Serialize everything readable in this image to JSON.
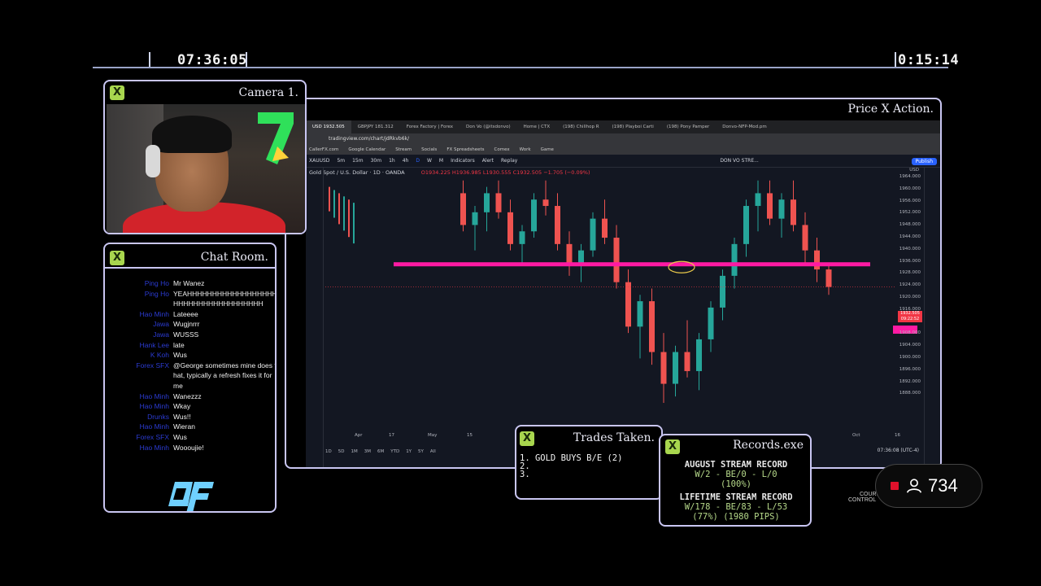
{
  "clocks": {
    "left": "07:36:05",
    "right": "0:15:14"
  },
  "camera": {
    "badge": "X",
    "title": "Camera 1."
  },
  "chat": {
    "badge": "X",
    "title": "Chat Room.",
    "messages": [
      {
        "user": "Ping Ho",
        "text": "Mr Wanez"
      },
      {
        "user": "Ping Ho",
        "text": "YEAHHHHHHHHHHHHHHHHHHHHHHHHHHHHHHHHHHHH"
      },
      {
        "user": "Hao Minh",
        "text": "Lateeee"
      },
      {
        "user": "Jawa",
        "text": "Wugjnrrr"
      },
      {
        "user": "Jawa",
        "text": "WUSSS"
      },
      {
        "user": "Hank Lee",
        "text": "late"
      },
      {
        "user": "K Koh",
        "text": "Wus"
      },
      {
        "user": "Forex SFX",
        "text": "@George sometimes mine does that, typically a refresh fixes it for me"
      },
      {
        "user": "Hao Minh",
        "text": "Wanezzz"
      },
      {
        "user": "Hao Minh",
        "text": "Wkay"
      },
      {
        "user": "Drunks",
        "text": "Wus!!"
      },
      {
        "user": "Hao Minh",
        "text": "Wieran"
      },
      {
        "user": "Forex SFX",
        "text": "Wus"
      },
      {
        "user": "Hao Minh",
        "text": "Woooujie!"
      }
    ]
  },
  "chart_panel": {
    "title": "Price X Action.",
    "tabs": [
      "USD 1932.505",
      "GBPJPY 181.312",
      "Forex Factory | Forex",
      "Don Vo (@itsdonvo)",
      "Home | CTX",
      "(198) Chillhop R",
      "(198) Playboi Carti",
      "(198) Pony Pamper",
      "Donvo-NFP-Mod.pm"
    ],
    "url": "tradingview.com/chart/jdRkvb6k/",
    "bookmarks": [
      "CallerFX.com",
      "Google Calendar",
      "Stream",
      "Socials",
      "FX Spreadsheets",
      "Comex",
      "Work",
      "Game"
    ],
    "toolbar": [
      "XAUUSD",
      "5m",
      "15m",
      "30m",
      "1h",
      "4h",
      "D",
      "W",
      "M",
      "Indicators",
      "Alert",
      "Replay"
    ],
    "layout_name": "DON VO STRE...",
    "publish": "Publish",
    "symbol": "Gold Spot / U.S. Dollar · 1D · OANDA",
    "ohlc": "O1934.225 H1936.985 L1930.555 C1932.505 −1.705 (−0.09%)",
    "currency": "USD",
    "y_ticks": [
      "1964.000",
      "1960.000",
      "1956.000",
      "1952.000",
      "1948.000",
      "1944.000",
      "1940.000",
      "1936.000",
      "1928.000",
      "1924.000",
      "1920.000",
      "1916.000",
      "1912.000",
      "1908.000",
      "1904.000",
      "1900.000",
      "1896.000",
      "1892.000",
      "1888.000"
    ],
    "x_ticks": [
      "Apr",
      "17",
      "May",
      "15",
      "Jun",
      "Oct",
      "16"
    ],
    "price_tag": "1932.505",
    "price_tag_time": "09:22:52",
    "ranges": [
      "1D",
      "5D",
      "1M",
      "3M",
      "6M",
      "YTD",
      "1Y",
      "5Y",
      "All"
    ],
    "time_utc": "07:36:08 (UTC-4)"
  },
  "chart_data": {
    "type": "candlestick",
    "symbol": "XAUUSD",
    "timeframe": "1D",
    "horizontal_line": 1939.5,
    "ylim": [
      1886,
      1968
    ],
    "candles": [
      [
        1962,
        1966,
        1950,
        1952
      ],
      [
        1952,
        1958,
        1944,
        1956
      ],
      [
        1956,
        1964,
        1950,
        1962
      ],
      [
        1962,
        1966,
        1954,
        1956
      ],
      [
        1956,
        1960,
        1944,
        1946
      ],
      [
        1946,
        1952,
        1940,
        1950
      ],
      [
        1950,
        1962,
        1948,
        1960
      ],
      [
        1960,
        1966,
        1955,
        1958
      ],
      [
        1958,
        1962,
        1944,
        1946
      ],
      [
        1946,
        1950,
        1936,
        1940
      ],
      [
        1940,
        1946,
        1934,
        1944
      ],
      [
        1944,
        1956,
        1942,
        1954
      ],
      [
        1954,
        1960,
        1946,
        1948
      ],
      [
        1948,
        1952,
        1932,
        1934
      ],
      [
        1934,
        1938,
        1918,
        1920
      ],
      [
        1920,
        1930,
        1910,
        1928
      ],
      [
        1928,
        1932,
        1908,
        1912
      ],
      [
        1912,
        1918,
        1896,
        1902
      ],
      [
        1902,
        1914,
        1898,
        1912
      ],
      [
        1912,
        1922,
        1904,
        1906
      ],
      [
        1906,
        1918,
        1900,
        1916
      ],
      [
        1916,
        1928,
        1912,
        1926
      ],
      [
        1926,
        1938,
        1922,
        1936
      ],
      [
        1936,
        1948,
        1932,
        1946
      ],
      [
        1946,
        1960,
        1942,
        1958
      ],
      [
        1958,
        1966,
        1950,
        1962
      ],
      [
        1962,
        1966,
        1952,
        1954
      ],
      [
        1954,
        1962,
        1948,
        1960
      ],
      [
        1960,
        1966,
        1950,
        1952
      ],
      [
        1952,
        1956,
        1940,
        1944
      ],
      [
        1944,
        1948,
        1934,
        1938
      ],
      [
        1938,
        1940,
        1930,
        1932.5
      ]
    ]
  },
  "trades": {
    "badge": "X",
    "title": "Trades Taken.",
    "items": [
      "1.  GOLD BUYS B/E (2)",
      "2.",
      "3."
    ]
  },
  "records": {
    "badge": "X",
    "title": "Records.exe",
    "august_heading": "AUGUST STREAM RECORD",
    "august_line1": "W/2 - BE/0 - L/0",
    "august_line2": "(100%)",
    "lifetime_heading": "LIFETIME STREAM RECORD",
    "lifetime_line1": "W/178 - BE/83 - L/53",
    "lifetime_line2": "(77%) (1980 PIPS)"
  },
  "viewers": {
    "count": "734"
  },
  "footer": {
    "line1": "COURSE",
    "line2": "CONTROL"
  },
  "colors": {
    "panel_border": "#c9c6f2",
    "badge": "#a8d64e",
    "level_line": "#ff1aa3",
    "up": "#26a69a",
    "down": "#ef5350"
  }
}
